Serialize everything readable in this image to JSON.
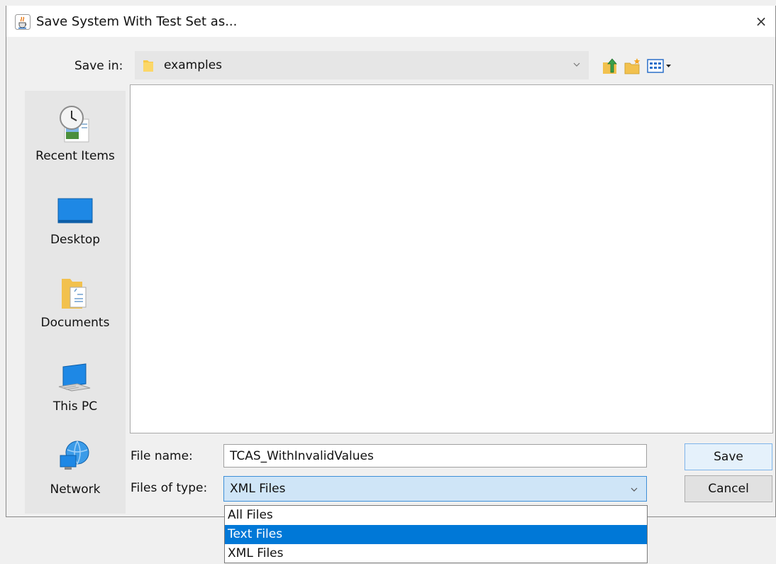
{
  "window": {
    "title": "Save System With Test Set as...",
    "close_glyph": "×",
    "icon": "java-cup-icon"
  },
  "save_in": {
    "label": "Save in:",
    "value": "examples",
    "icon": "folder-icon"
  },
  "toolbar": {
    "icons": [
      "up-one-level-icon",
      "new-folder-icon",
      "view-menu-icon"
    ]
  },
  "places": [
    {
      "label": "Recent Items",
      "icon": "recent-items-icon"
    },
    {
      "label": "Desktop",
      "icon": "desktop-icon"
    },
    {
      "label": "Documents",
      "icon": "documents-icon"
    },
    {
      "label": "This PC",
      "icon": "this-pc-icon"
    },
    {
      "label": "Network",
      "icon": "network-icon"
    }
  ],
  "file_name": {
    "label": "File name:",
    "value": "TCAS_WithInvalidValues"
  },
  "file_type": {
    "label": "Files of type:",
    "value": "XML Files",
    "options": [
      "All Files",
      "Text Files",
      "XML Files"
    ],
    "highlighted": "Text Files"
  },
  "buttons": {
    "save": "Save",
    "cancel": "Cancel"
  },
  "colors": {
    "accent": "#0078d7",
    "combo_focus_bg": "#cfe5f7"
  }
}
